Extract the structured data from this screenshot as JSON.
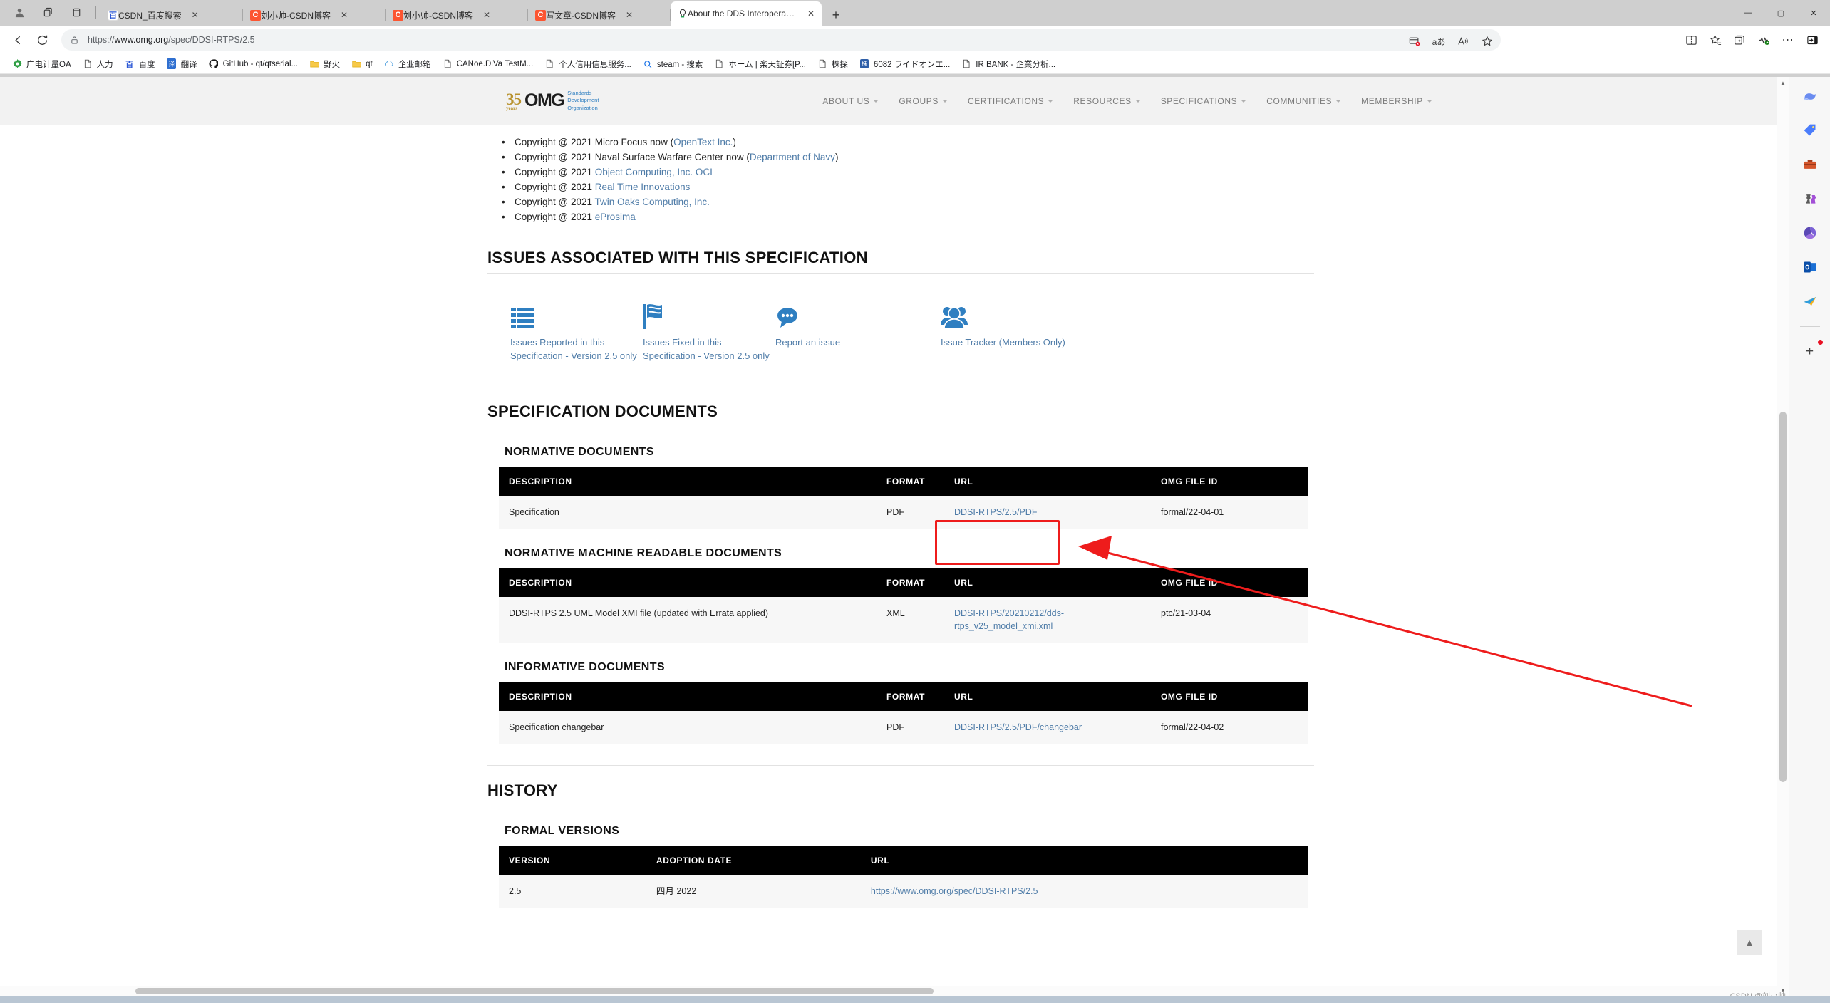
{
  "browser": {
    "window_controls": {
      "minimize": "—",
      "maximize": "▢",
      "close": "✕"
    },
    "left_icons": [
      {
        "name": "profile-icon",
        "glyph": "👤"
      },
      {
        "name": "tab-actions-icon",
        "glyph": "⧉"
      },
      {
        "name": "vertical-tabs-icon",
        "glyph": "▯"
      }
    ],
    "tabs": [
      {
        "title": "CSDN_百度搜索",
        "favicon": "baidu",
        "active": false
      },
      {
        "title": "刘小帅-CSDN博客",
        "favicon": "csdn",
        "active": false
      },
      {
        "title": "刘小帅-CSDN博客",
        "favicon": "csdn",
        "active": false
      },
      {
        "title": "写文章-CSDN博客",
        "favicon": "csdn",
        "active": false
      },
      {
        "title": "About the DDS Interoperability W",
        "favicon": "omg",
        "active": true
      }
    ],
    "new_tab_label": "+",
    "nav": {
      "back_icon": "←",
      "refresh_icon": "⟳",
      "lock_icon": "padlock-icon"
    },
    "address": {
      "scheme": "https://",
      "host": "www.omg.org",
      "path": "/spec/DDSI-RTPS/2.5",
      "full": "https://www.omg.org/spec/DDSI-RTPS/2.5"
    },
    "omni_actions": [
      {
        "name": "split-payment-icon",
        "glyph": "▤"
      },
      {
        "name": "translate-icon",
        "glyph": "aあ"
      },
      {
        "name": "read-aloud-icon",
        "glyph": "A"
      },
      {
        "name": "add-favorite-icon",
        "glyph": "☆"
      }
    ],
    "toolbar_right": [
      {
        "name": "split-screen-icon",
        "glyph": "▯▯"
      },
      {
        "name": "favorites-icon",
        "glyph": "☆"
      },
      {
        "name": "collections-icon",
        "glyph": "⊞"
      },
      {
        "name": "browser-essentials-icon",
        "glyph": "⚕"
      },
      {
        "name": "settings-more-icon",
        "glyph": "⋯"
      },
      {
        "name": "sidebar-toggle-icon",
        "glyph": "⊡"
      }
    ],
    "bookmarks": [
      {
        "label": "广电计量OA",
        "icon": "gear"
      },
      {
        "label": "人力",
        "icon": "page"
      },
      {
        "label": "百度",
        "icon": "baidu"
      },
      {
        "label": "翻译",
        "icon": "translate"
      },
      {
        "label": "GitHub - qt/qtserial...",
        "icon": "github"
      },
      {
        "label": "野火",
        "icon": "folder"
      },
      {
        "label": "qt",
        "icon": "folder"
      },
      {
        "label": "企业邮箱",
        "icon": "cloud"
      },
      {
        "label": "CANoe.DiVa TestM...",
        "icon": "page"
      },
      {
        "label": "个人信用信息服务...",
        "icon": "page"
      },
      {
        "label": "steam - 搜索",
        "icon": "search"
      },
      {
        "label": "ホーム | 楽天証券[P...",
        "icon": "page"
      },
      {
        "label": "株探",
        "icon": "page"
      },
      {
        "label": "6082 ライドオンエ...",
        "icon": "kabu"
      },
      {
        "label": "IR BANK - 企業分析...",
        "icon": "page"
      }
    ]
  },
  "site": {
    "logo": {
      "anniversary": "35",
      "years": "years",
      "name": "OMG",
      "tagline": "Standards\nDevelopment\nOrganization"
    },
    "nav": [
      {
        "label": "ABOUT US",
        "has_caret": true
      },
      {
        "label": "GROUPS",
        "has_caret": true
      },
      {
        "label": "CERTIFICATIONS",
        "has_caret": true
      },
      {
        "label": "RESOURCES",
        "has_caret": true
      },
      {
        "label": "SPECIFICATIONS",
        "has_caret": true
      },
      {
        "label": "COMMUNITIES",
        "has_caret": true
      },
      {
        "label": "MEMBERSHIP",
        "has_caret": true
      }
    ]
  },
  "page": {
    "copyright_items": [
      {
        "prefix": "Copyright @ 2021 ",
        "struck": "Micro Focus",
        "mid": " now (",
        "link": "OpenText Inc.",
        "suffix": ")"
      },
      {
        "prefix": "Copyright @ 2021 ",
        "struck": "Naval Surface Warfare Center",
        "mid": " now (",
        "link": "Department of Navy",
        "suffix": ")"
      },
      {
        "prefix": "Copyright @ 2021 ",
        "struck": "",
        "mid": "",
        "link": "Object Computing, Inc. OCI",
        "suffix": ""
      },
      {
        "prefix": "Copyright @ 2021 ",
        "struck": "",
        "mid": "",
        "link": "Real Time Innovations",
        "suffix": ""
      },
      {
        "prefix": "Copyright @ 2021 ",
        "struck": "",
        "mid": "",
        "link": "Twin Oaks Computing, Inc.",
        "suffix": ""
      },
      {
        "prefix": "Copyright @ 2021 ",
        "struck": "",
        "mid": "",
        "link": "eProsima",
        "suffix": ""
      }
    ],
    "issues_heading": "ISSUES ASSOCIATED WITH THIS SPECIFICATION",
    "issues": [
      {
        "icon": "list-icon",
        "label": "Issues Reported in this Specification  - Version 2.5 only"
      },
      {
        "icon": "flag-icon",
        "label": "Issues Fixed in this Specification  - Version 2.5 only"
      },
      {
        "icon": "comment-icon",
        "label": "Report an issue"
      },
      {
        "icon": "users-icon",
        "label": "Issue Tracker (Members Only)"
      }
    ],
    "spec_docs_heading": "SPECIFICATION DOCUMENTS",
    "normative_heading": "NORMATIVE DOCUMENTS",
    "machine_heading": "NORMATIVE MACHINE READABLE DOCUMENTS",
    "informative_heading": "INFORMATIVE DOCUMENTS",
    "doc_columns": [
      "DESCRIPTION",
      "FORMAT",
      "URL",
      "OMG FILE ID"
    ],
    "normative_rows": [
      {
        "description": "Specification",
        "format": "PDF",
        "url": "DDSI-RTPS/2.5/PDF",
        "file_id": "formal/22-04-01"
      }
    ],
    "machine_rows": [
      {
        "description": "DDSI-RTPS 2.5 UML Model XMI file (updated with Errata applied)",
        "format": "XML",
        "url": "DDSI-RTPS/20210212/dds-rtps_v25_model_xmi.xml",
        "file_id": "ptc/21-03-04"
      }
    ],
    "informative_rows": [
      {
        "description": "Specification changebar",
        "format": "PDF",
        "url": "DDSI-RTPS/2.5/PDF/changebar",
        "file_id": "formal/22-04-02"
      }
    ],
    "history_heading": "HISTORY",
    "formal_versions_heading": "FORMAL VERSIONS",
    "version_columns": [
      "VERSION",
      "ADOPTION DATE",
      "URL"
    ],
    "version_rows": [
      {
        "version": "2.5",
        "adoption_date": "四月 2022",
        "url": "https://www.omg.org/spec/DDSI-RTPS/2.5"
      }
    ]
  },
  "annotation": {
    "highlight_color": "#ee1c1c",
    "highlight_target": "DDSI-RTPS/2.5/PDF"
  },
  "edge_sidebar": [
    {
      "name": "copilot-icon",
      "glyph": "◈"
    },
    {
      "name": "shopping-tag-icon",
      "glyph": "🏷"
    },
    {
      "name": "tools-icon",
      "glyph": "🧰"
    },
    {
      "name": "games-icon",
      "glyph": "♟"
    },
    {
      "name": "office-icon",
      "glyph": "❖"
    },
    {
      "name": "outlook-icon",
      "glyph": "✉"
    },
    {
      "name": "send-icon",
      "glyph": "✈"
    },
    {
      "name": "add-sidebar-app-icon",
      "glyph": "+"
    }
  ],
  "misc": {
    "back_to_top": "▲",
    "watermark": "CSDN @刘小帅"
  }
}
